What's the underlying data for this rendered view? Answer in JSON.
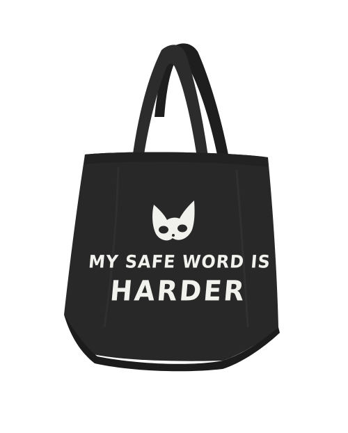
{
  "product_image": {
    "background_color": "#ffffff",
    "bag_color": "#282828",
    "print_color": "#f1f1ee",
    "print": {
      "line_1": "MY SAFE WORD IS",
      "line_2": "HARDER",
      "graphic": "cat-mask-icon"
    }
  }
}
